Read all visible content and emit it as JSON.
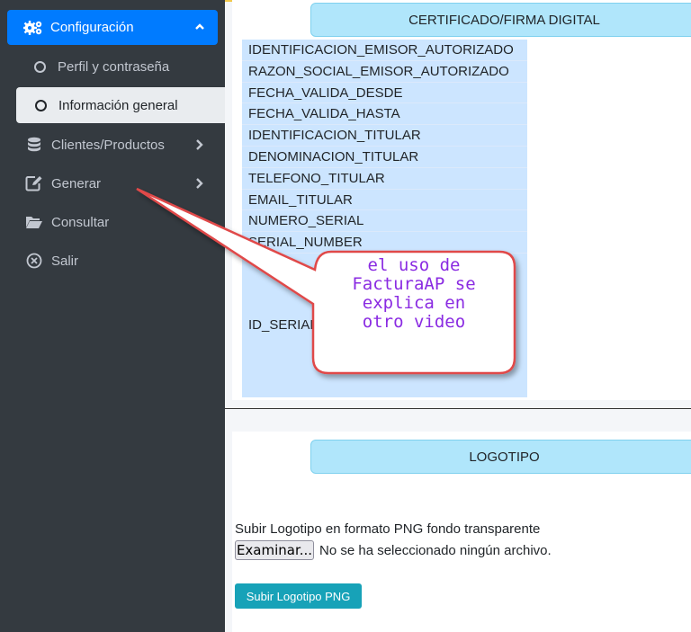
{
  "sidebar": {
    "configuracion": "Configuración",
    "perfil": "Perfil y contraseña",
    "informacion": "Información general",
    "clientes": "Clientes/Productos",
    "generar": "Generar",
    "consultar": "Consultar",
    "salir": "Salir"
  },
  "certificado": {
    "header": "CERTIFICADO/FIRMA DIGITAL",
    "rows": [
      "IDENTIFICACION_EMISOR_AUTORIZADO",
      "RAZON_SOCIAL_EMISOR_AUTORIZADO",
      "FECHA_VALIDA_DESDE",
      "FECHA_VALIDA_HASTA",
      "IDENTIFICACION_TITULAR",
      "DENOMINACION_TITULAR",
      "TELEFONO_TITULAR",
      "EMAIL_TITULAR",
      "NUMERO_SERIAL",
      "SERIAL_NUMBER"
    ],
    "id_serial": "ID_SERIAL"
  },
  "callout": {
    "line1": "el uso de",
    "line2": "FacturaAP se",
    "line3": "explica en",
    "line4": "otro video"
  },
  "logotipo": {
    "header": "LOGOTIPO",
    "instructions": "Subir Logotipo en formato PNG fondo transparente",
    "file_button": "Examinar...",
    "file_status": "No se ha seleccionado ningún archivo.",
    "upload_button": "Subir Logotipo PNG"
  },
  "colors": {
    "sidebar_bg": "#343a40",
    "active_blue": "#007bff",
    "header_cyan": "#b0e6fb",
    "table_blue": "#cce5ff",
    "upload_teal": "#17a2b8",
    "callout_red": "#e04848",
    "callout_text": "#8a2be2"
  }
}
